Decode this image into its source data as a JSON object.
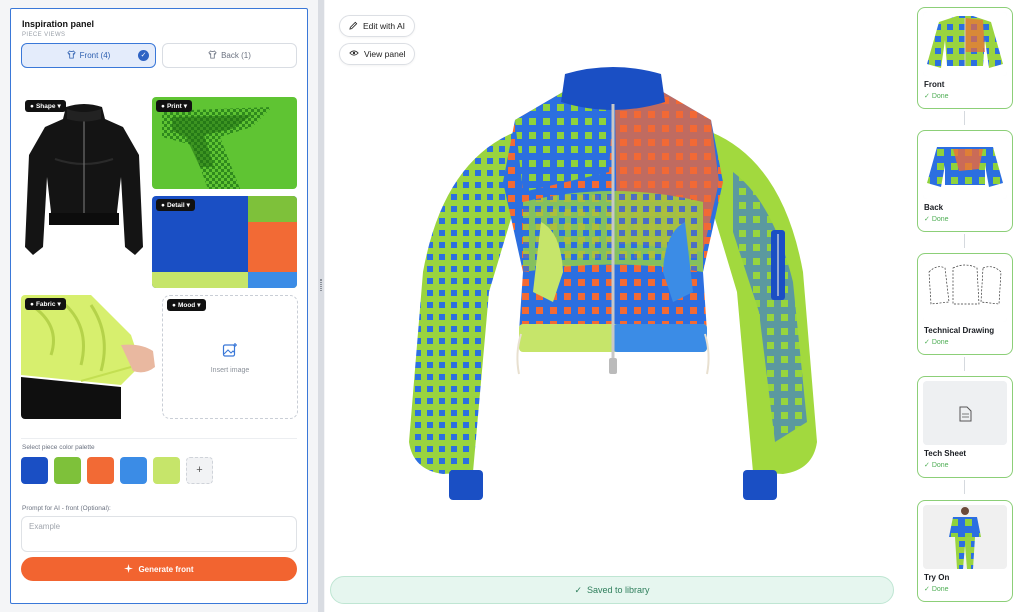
{
  "panel": {
    "title": "Inspiration panel",
    "subtitle": "PIECE VIEWS",
    "views": [
      {
        "label": "Front (4)",
        "selected": true
      },
      {
        "label": "Back (1)",
        "selected": false
      }
    ]
  },
  "tiles": {
    "shape": "Shape",
    "print": "Print",
    "detail": "Detail",
    "fabric": "Fabric",
    "mood": "Mood",
    "insert_image": "Insert image"
  },
  "palette": {
    "label": "Select piece color palette",
    "colors": [
      "#1a4fc4",
      "#7ec13a",
      "#f26a35",
      "#3b8ce6",
      "#c6e56a"
    ],
    "add_label": "+"
  },
  "prompt": {
    "label": "Prompt for AI - front (Optional):",
    "placeholder": "Example"
  },
  "generate_button": "Generate front",
  "canvas": {
    "edit_button": "Edit with AI",
    "view_button": "View panel",
    "saved_banner": "Saved to library"
  },
  "steps": [
    {
      "name": "Front",
      "status": "Done"
    },
    {
      "name": "Back",
      "status": "Done"
    },
    {
      "name": "Technical Drawing",
      "status": "Done"
    },
    {
      "name": "Tech Sheet",
      "status": "Done"
    },
    {
      "name": "Try On",
      "status": "Done"
    }
  ],
  "colors": {
    "accent_blue": "#3a78d8",
    "generate_orange": "#f26430",
    "done_green": "#4fae55",
    "saved_green": "#2f7f5c"
  }
}
